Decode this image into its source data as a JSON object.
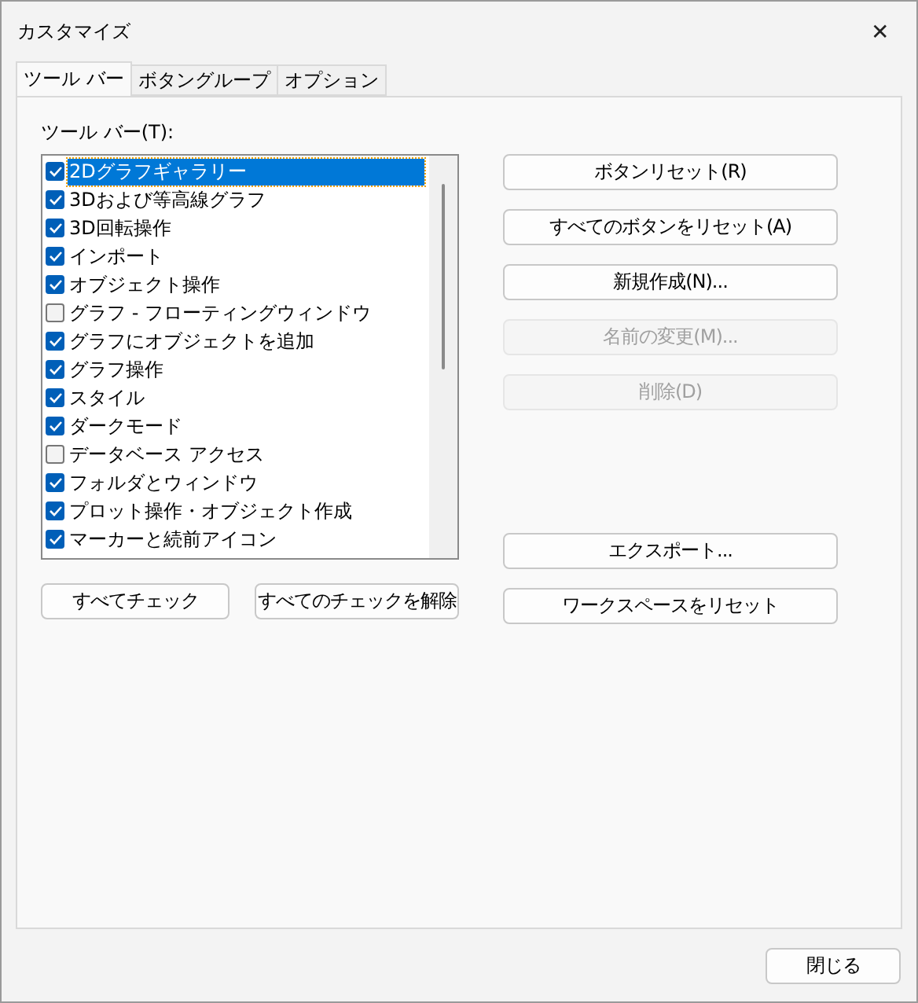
{
  "window": {
    "title": "カスタマイズ",
    "close": "✕"
  },
  "tabs": [
    {
      "label": "ツール バー",
      "selected": true
    },
    {
      "label": "ボタングループ",
      "selected": false
    },
    {
      "label": "オプション",
      "selected": false
    }
  ],
  "toolbar_list": {
    "label": "ツール バー(T):",
    "items": [
      {
        "label": "2Dグラフギャラリー",
        "checked": true,
        "selected": true
      },
      {
        "label": "3Dおよび等高線グラフ",
        "checked": true,
        "selected": false
      },
      {
        "label": "3D回転操作",
        "checked": true,
        "selected": false
      },
      {
        "label": "インポート",
        "checked": true,
        "selected": false
      },
      {
        "label": "オブジェクト操作",
        "checked": true,
        "selected": false
      },
      {
        "label": "グラフ - フローティングウィンドウ",
        "checked": false,
        "selected": false
      },
      {
        "label": "グラフにオブジェクトを追加",
        "checked": true,
        "selected": false
      },
      {
        "label": "グラフ操作",
        "checked": true,
        "selected": false
      },
      {
        "label": "スタイル",
        "checked": true,
        "selected": false
      },
      {
        "label": "ダークモード",
        "checked": true,
        "selected": false
      },
      {
        "label": "データベース アクセス",
        "checked": false,
        "selected": false
      },
      {
        "label": "フォルダとウィンドウ",
        "checked": true,
        "selected": false
      },
      {
        "label": "プロット操作・オブジェクト作成",
        "checked": true,
        "selected": false
      },
      {
        "label": "マーカーと続前アイコン",
        "checked": true,
        "selected": false
      }
    ]
  },
  "list_buttons": [
    "すべてチェック",
    "すべてのチェックを解除"
  ],
  "action_buttons": [
    {
      "label": "ボタンリセット(R)",
      "disabled": false
    },
    {
      "label": "すべてのボタンをリセット(A)",
      "disabled": false
    },
    {
      "label": "新規作成(N)...",
      "disabled": false
    },
    {
      "label": "名前の変更(M)...",
      "disabled": true
    },
    {
      "label": "削除(D)",
      "disabled": true
    }
  ],
  "lower_buttons": [
    "エクスポート...",
    "ワークスペースをリセット"
  ],
  "footer_button": "閉じる"
}
